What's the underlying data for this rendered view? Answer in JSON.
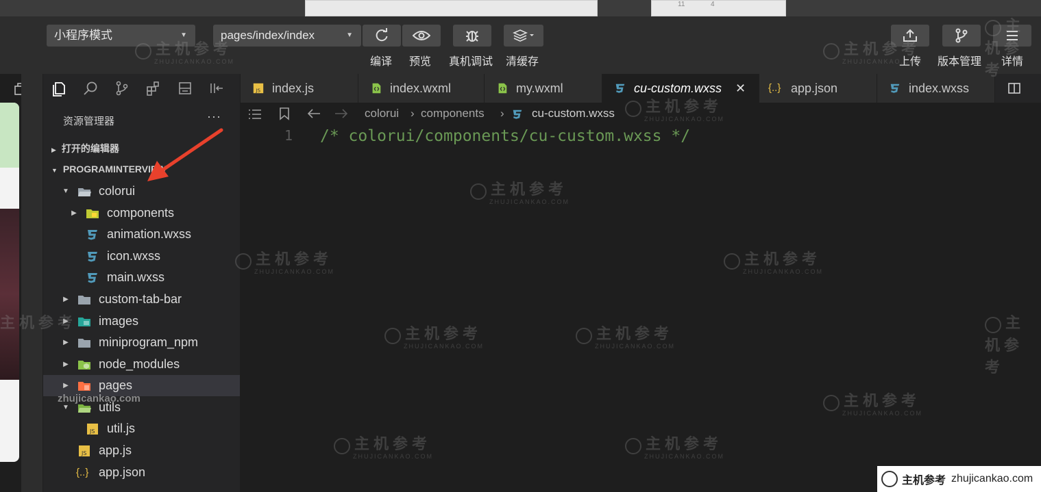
{
  "toolbar": {
    "mode_select": "小程序模式",
    "page_select": "pages/index/index",
    "compile_label": "编译",
    "preview_label": "预览",
    "debug_label": "真机调试",
    "clear_cache_label": "清缓存",
    "upload_label": "上传",
    "version_label": "版本管理",
    "details_label": "详情"
  },
  "topstrip": {
    "likes": "11",
    "comments": "4"
  },
  "sidebar": {
    "title": "资源管理器",
    "more": "···",
    "open_editors": "打开的编辑器",
    "project": "PROGRAMINTERVIEW",
    "tree": [
      {
        "label": "colorui"
      },
      {
        "label": "components"
      },
      {
        "label": "animation.wxss"
      },
      {
        "label": "icon.wxss"
      },
      {
        "label": "main.wxss"
      },
      {
        "label": "custom-tab-bar"
      },
      {
        "label": "images"
      },
      {
        "label": "miniprogram_npm"
      },
      {
        "label": "node_modules"
      },
      {
        "label": "pages"
      },
      {
        "label": "utils"
      },
      {
        "label": "util.js"
      },
      {
        "label": "app.js"
      },
      {
        "label": "app.json"
      }
    ]
  },
  "tabs": [
    {
      "label": "index.js"
    },
    {
      "label": "index.wxml"
    },
    {
      "label": "my.wxml"
    },
    {
      "label": "cu-custom.wxss"
    },
    {
      "label": "app.json"
    },
    {
      "label": "index.wxss"
    }
  ],
  "breadcrumb": {
    "part1": "colorui",
    "part2": "components",
    "part3": "cu-custom.wxss"
  },
  "code": {
    "line_number": "1",
    "line1": "/* colorui/components/cu-custom.wxss */"
  },
  "watermark": {
    "cn": "主机参考",
    "en": "ZHUJICANKAO.COM",
    "overlay": "zhujicankao.com",
    "badge_cn": "主机参考",
    "badge_url": "zhujicankao.com"
  },
  "colors": {
    "accent_comment": "#6a9955",
    "css_icon": "#519aba",
    "js_icon": "#e8bf45",
    "json_icon": "#e8bf45",
    "wxml_icon": "#8bc34a",
    "annotation_arrow": "#e8412c"
  }
}
